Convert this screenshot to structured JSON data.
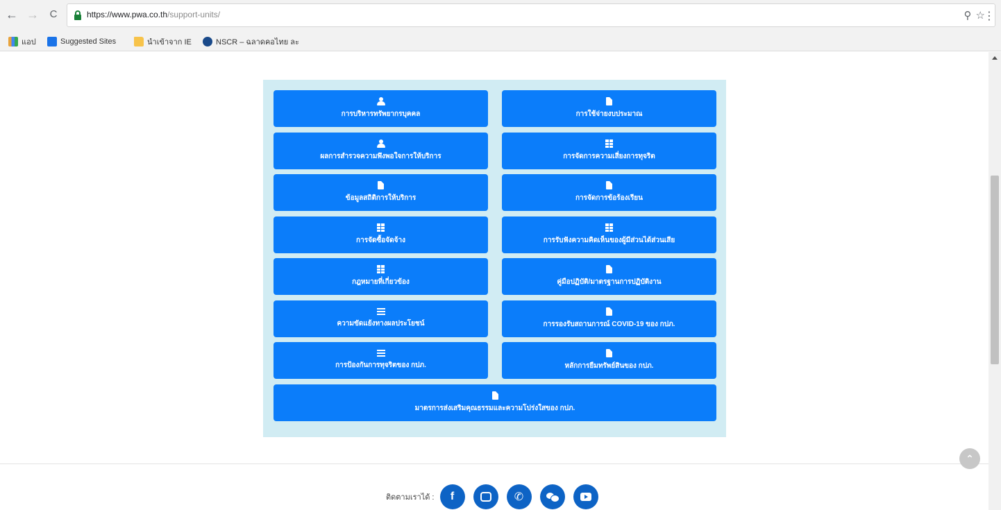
{
  "browser": {
    "nav": {
      "back": "←",
      "forward": "→",
      "reload": "C"
    },
    "url_host": "https://www.pwa.co.th",
    "url_path": "/support-units/",
    "omnibox_icons": {
      "zoom": "⚲",
      "star": "☆"
    },
    "menu": "⋮",
    "bookmarks": [
      {
        "label": "แอป",
        "icon": "apps-icon"
      },
      {
        "label": "Suggested Sites",
        "icon": "suggested-sites-icon"
      },
      {
        "label": "นำเข้าจาก IE",
        "icon": "folder-icon"
      },
      {
        "label": "NSCR – ฉลาดคอไทย ละ",
        "icon": "globe-icon"
      }
    ]
  },
  "menu_buttons": [
    {
      "label": "การบริหารทรัพยากรบุคคล",
      "icon": "user-icon"
    },
    {
      "label": "การใช้จ่ายงบประมาณ",
      "icon": "document-icon"
    },
    {
      "label": "ผลการสำรวจความพึงพอใจการให้บริการ",
      "icon": "user-icon"
    },
    {
      "label": "การจัดการความเสี่ยงการทุจริต",
      "icon": "table-icon"
    },
    {
      "label": "ข้อมูลสถิติการให้บริการ",
      "icon": "document-icon"
    },
    {
      "label": "การจัดการข้อร้องเรียน",
      "icon": "document-icon"
    },
    {
      "label": "การจัดซื้อจัดจ้าง",
      "icon": "table-icon"
    },
    {
      "label": "การรับฟังความคิดเห็นของผู้มีส่วนได้ส่วนเสีย",
      "icon": "table-icon"
    },
    {
      "label": "กฎหมายที่เกี่ยวข้อง",
      "icon": "table-icon"
    },
    {
      "label": "คู่มือปฏิบัติ/มาตรฐานการปฏิบัติงาน",
      "icon": "document-icon"
    },
    {
      "label": "ความขัดแย้งทางผลประโยชน์",
      "icon": "list-icon"
    },
    {
      "label": "การรองรับสถานการณ์ COVID-19 ของ กปภ.",
      "icon": "document-icon"
    },
    {
      "label": "การป้องกันการทุจริตของ กปภ.",
      "icon": "list-icon"
    },
    {
      "label": "หลักการยืมทรัพย์สินของ กปภ.",
      "icon": "document-icon"
    },
    {
      "label": "มาตรการส่งเสริมคุณธรรมและความโปร่งใสของ กปภ.",
      "icon": "document-icon"
    }
  ],
  "footer": {
    "follow_label": "ติดตามเราได้ :",
    "social": [
      {
        "name": "facebook-icon",
        "glyph": "f"
      },
      {
        "name": "line-icon",
        "glyph": ""
      },
      {
        "name": "phone-icon",
        "glyph": "✆"
      },
      {
        "name": "chat-icon",
        "glyph": ""
      },
      {
        "name": "youtube-icon",
        "glyph": ""
      }
    ],
    "back_to_top": "⌃"
  },
  "colors": {
    "button": "#0b7dfa",
    "panel": "#d1ecf3",
    "social": "#0d63c5"
  }
}
